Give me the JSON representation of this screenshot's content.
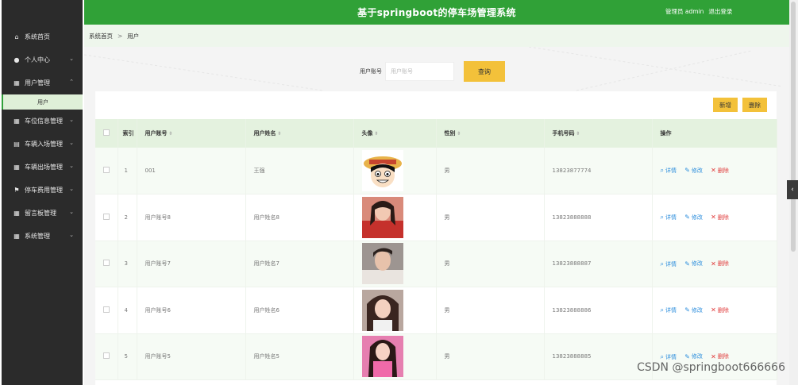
{
  "app": {
    "title": "基于springboot的停车场管理系统",
    "role_label": "管理员 admin",
    "logout_label": "退出登录"
  },
  "sidebar": {
    "items": [
      {
        "icon": "home-icon",
        "glyph": "⌂",
        "label": "系统首页",
        "chevron": false
      },
      {
        "icon": "user-icon",
        "glyph": "●",
        "label": "个人中心",
        "chevron": true
      },
      {
        "icon": "grid-icon",
        "glyph": "▦",
        "label": "用户管理",
        "chevron": true,
        "expanded": true
      },
      {
        "icon": "grid-icon",
        "glyph": "▦",
        "label": "车位信息管理",
        "chevron": true
      },
      {
        "icon": "clipboard-icon",
        "glyph": "▤",
        "label": "车辆入场管理",
        "chevron": true
      },
      {
        "icon": "grid-icon",
        "glyph": "▦",
        "label": "车辆出场管理",
        "chevron": true
      },
      {
        "icon": "flag-icon",
        "glyph": "⚑",
        "label": "停车费用管理",
        "chevron": true
      },
      {
        "icon": "grid-icon",
        "glyph": "▦",
        "label": "留言板管理",
        "chevron": true
      },
      {
        "icon": "grid-icon",
        "glyph": "▦",
        "label": "系统管理",
        "chevron": true
      }
    ],
    "submenu": {
      "label": "用户"
    }
  },
  "breadcrumb": {
    "home": "系统首页",
    "separator": ">",
    "current": "用户"
  },
  "search": {
    "label": "用户账号",
    "placeholder": "用户账号",
    "button": "查询"
  },
  "actions": {
    "add": "新增",
    "delete": "删除"
  },
  "table": {
    "headers": {
      "index": "索引",
      "account": "用户账号",
      "name": "用户姓名",
      "avatar": "头像",
      "gender": "性别",
      "phone": "手机号码",
      "ops": "操作"
    },
    "ops": {
      "detail": "详情",
      "edit": "修改",
      "delete": "删除"
    },
    "rows": [
      {
        "index": "1",
        "account": "001",
        "name": "王强",
        "avatar": "cartoon-avatar",
        "gender": "男",
        "phone": "13823877774"
      },
      {
        "index": "2",
        "account": "用户账号8",
        "name": "用户姓名8",
        "avatar": "photo-avatar-red",
        "gender": "男",
        "phone": "13823888888"
      },
      {
        "index": "3",
        "account": "用户账号7",
        "name": "用户姓名7",
        "avatar": "photo-avatar-man",
        "gender": "男",
        "phone": "13823888887"
      },
      {
        "index": "4",
        "account": "用户账号6",
        "name": "用户姓名6",
        "avatar": "photo-avatar-woman",
        "gender": "男",
        "phone": "13823888886"
      },
      {
        "index": "5",
        "account": "用户账号5",
        "name": "用户姓名5",
        "avatar": "photo-avatar-pink",
        "gender": "男",
        "phone": "13823888885"
      }
    ]
  },
  "watermark": "CSDN @springboot666666",
  "colors": {
    "brand": "#30a137",
    "accent": "#f3c13a",
    "sidebar": "#2b2b2b",
    "link": "#2f8fdd",
    "danger": "#e03b3b"
  }
}
